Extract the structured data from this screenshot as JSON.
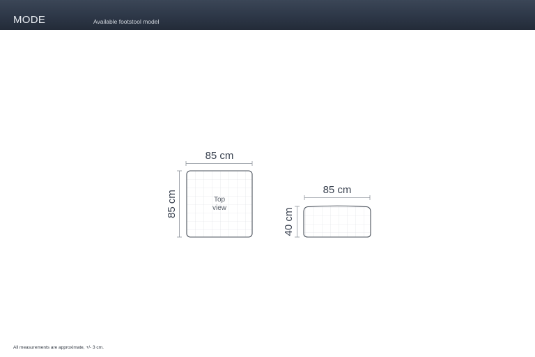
{
  "header": {
    "brand": "MODE",
    "subtitle": "Available footstool model"
  },
  "top_view": {
    "width_label": "85 cm",
    "depth_label": "85 cm",
    "center_label_line1": "Top",
    "center_label_line2": "view"
  },
  "side_view": {
    "width_label": "85 cm",
    "height_label": "40 cm"
  },
  "footer": {
    "note": "All measurements are approximate, +/- 3 cm."
  }
}
